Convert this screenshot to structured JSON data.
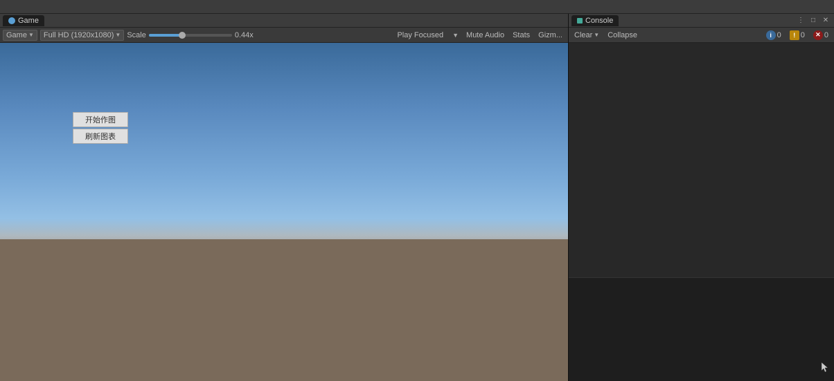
{
  "topbar": {
    "empty": ""
  },
  "game_panel": {
    "tab_label": "Game",
    "tab_icon_alt": "game-icon",
    "toolbar": {
      "display_dropdown_value": "Game",
      "resolution_dropdown_value": "Full HD (1920x1080)",
      "scale_label": "Scale",
      "scale_value": "0.44x",
      "play_focused_label": "Play Focused",
      "mute_audio_label": "Mute Audio",
      "stats_label": "Stats",
      "gizmos_label": "Gizm..."
    },
    "viewport": {
      "button1_label": "开始作图",
      "button2_label": "刷新图表"
    }
  },
  "console_panel": {
    "tab_label": "Console",
    "toolbar": {
      "clear_label": "Clear",
      "clear_dropdown": "",
      "collapse_label": "Collapse",
      "info_count": "0",
      "warn_count": "0",
      "error_count": "0"
    }
  }
}
